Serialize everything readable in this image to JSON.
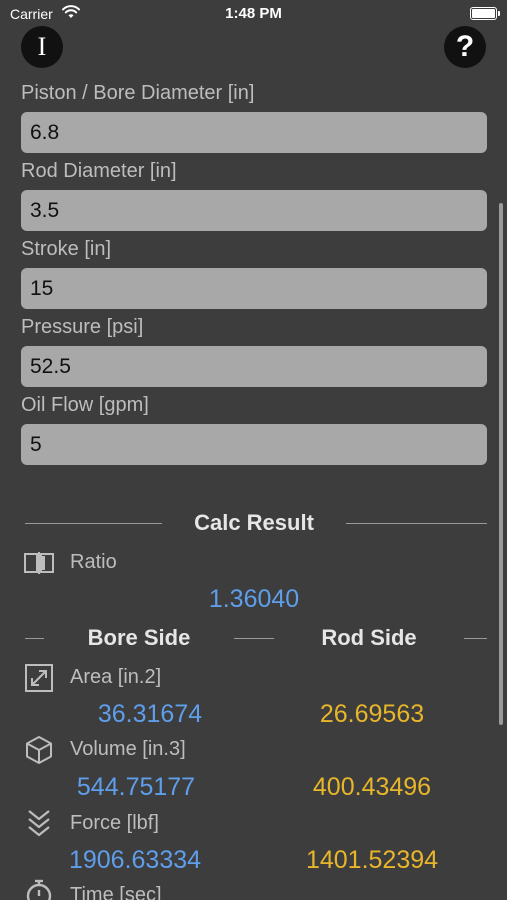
{
  "status_bar": {
    "carrier": "Carrier",
    "time": "1:48 PM"
  },
  "header": {
    "info_glyph": "I",
    "help_glyph": "?"
  },
  "inputs": [
    {
      "label": "Piston / Bore Diameter [in]",
      "value": "6.8"
    },
    {
      "label": "Rod Diameter  [in]",
      "value": "3.5"
    },
    {
      "label": "Stroke [in]",
      "value": "15"
    },
    {
      "label": "Pressure [psi]",
      "value": "52.5"
    },
    {
      "label": "Oil Flow [gpm]",
      "value": "5"
    }
  ],
  "results": {
    "title": "Calc Result",
    "ratio": {
      "label": "Ratio",
      "value": "1.36040"
    },
    "bore_header": "Bore Side",
    "rod_header": "Rod Side",
    "area": {
      "label": "Area [in.2]",
      "bore": "36.31674",
      "rod": "26.69563"
    },
    "volume": {
      "label": "Volume  [in.3]",
      "bore": "544.75177",
      "rod": "400.43496"
    },
    "force": {
      "label": "Force [lbf]",
      "bore": "1906.63334",
      "rod": "1401.52394"
    },
    "time": {
      "label": "Time [sec]"
    }
  },
  "colors": {
    "background": "#3d3d3d",
    "field": "#a8a8a8",
    "bore_value": "#5f9eea",
    "rod_value": "#e8b62a"
  },
  "icons": [
    "info-icon",
    "help-icon",
    "ratio-icon",
    "area-icon",
    "volume-icon",
    "force-icon",
    "time-icon"
  ]
}
